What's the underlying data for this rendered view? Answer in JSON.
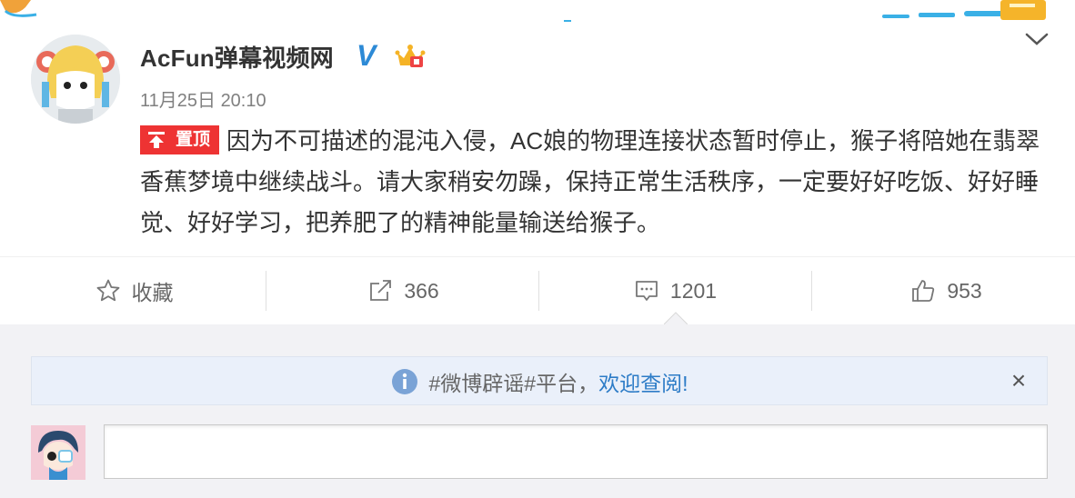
{
  "post": {
    "author": "AcFun弹幕视频网",
    "verified_mark": "V",
    "timestamp": "11月25日 20:10",
    "pin_label": "置顶",
    "content": "因为不可描述的混沌入侵，AC娘的物理连接状态暂时停止，猴子将陪她在翡翠香蕉梦境中继续战斗。请大家稍安勿躁，保持正常生活秩序，一定要好好吃饭、好好睡觉、好好学习，把养肥了的精神能量输送给猴子。"
  },
  "actions": {
    "favorite_label": "收藏",
    "repost_count": "366",
    "comment_count": "1201",
    "like_count": "953"
  },
  "notice": {
    "prefix": "#微博辟谣#平台，",
    "link_text": "欢迎查阅!",
    "close_glyph": "×"
  },
  "icons": {
    "pin": "pin-to-top-icon",
    "favorite": "star-icon",
    "repost": "share-icon",
    "comment": "comment-icon",
    "like": "thumbs-up-icon",
    "info": "info-icon",
    "more": "chevron-down-icon"
  },
  "colors": {
    "pin_red": "#ee3333",
    "verified_blue": "#2d8ad6",
    "link_blue": "#2d7cc7",
    "notice_bg": "#eaf0fa"
  }
}
